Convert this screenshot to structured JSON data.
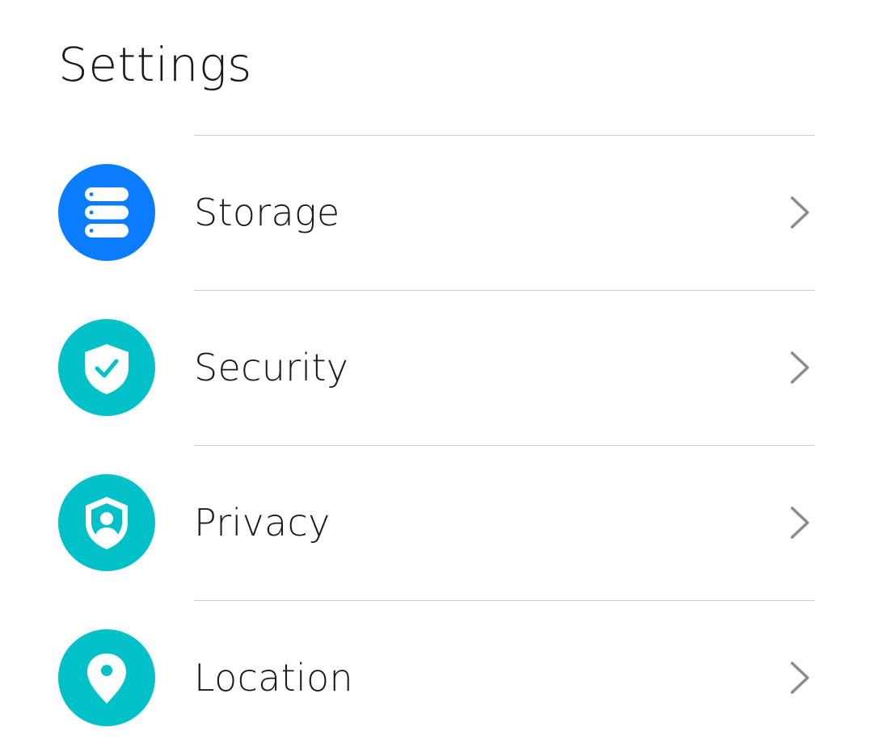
{
  "header": {
    "title": "Settings"
  },
  "settings": {
    "items": [
      {
        "label": "Storage",
        "icon": "storage-icon",
        "color": "#0a7cff"
      },
      {
        "label": "Security",
        "icon": "shield-check-icon",
        "color": "#00c1c7"
      },
      {
        "label": "Privacy",
        "icon": "privacy-icon",
        "color": "#00c1c7"
      },
      {
        "label": "Location",
        "icon": "location-pin-icon",
        "color": "#00c1c7"
      }
    ],
    "chevron_icon": "chevron-right-icon"
  }
}
